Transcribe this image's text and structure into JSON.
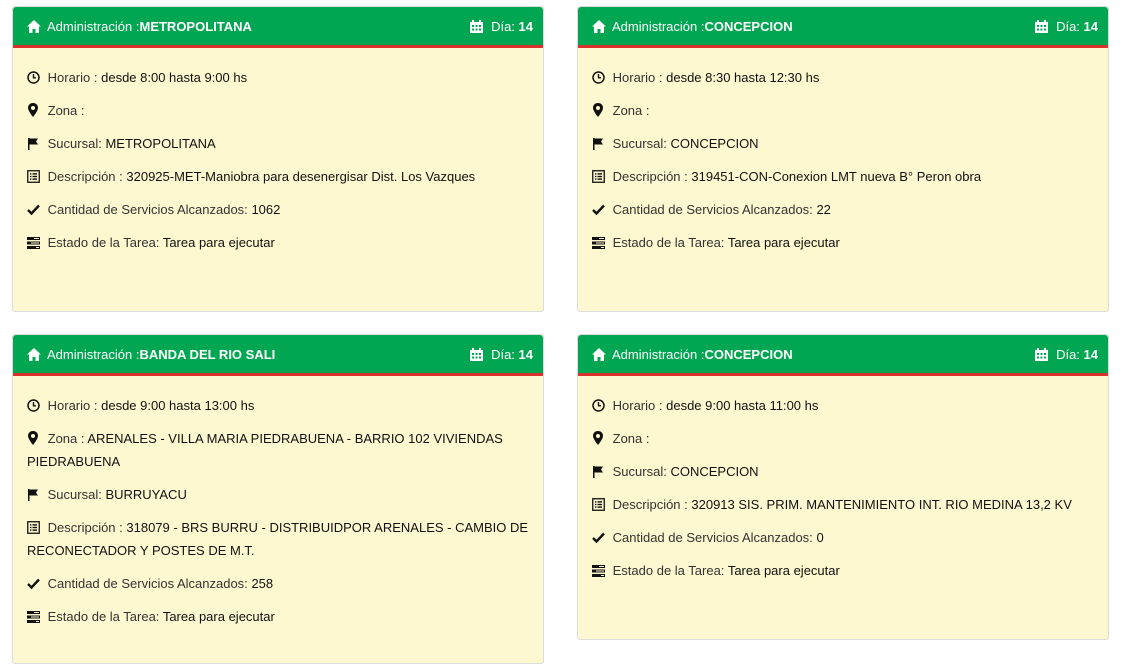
{
  "cards": [
    {
      "admin_label": "Administración :",
      "admin_value": "METROPOLITANA",
      "day_label": "Día:",
      "day_value": "14",
      "horario_label": "Horario :",
      "horario_value": "desde 8:00 hasta 9:00 hs",
      "zona_label": "Zona :",
      "zona_value": "",
      "sucursal_label": "Sucursal:",
      "sucursal_value": "METROPOLITANA",
      "descripcion_label": "Descripción :",
      "descripcion_value": "320925-MET-Maniobra para desenergisar Dist. Los Vazques",
      "servicios_label": "Cantidad de Servicios Alcanzados:",
      "servicios_value": "1062",
      "estado_label": "Estado de la Tarea:",
      "estado_value": "Tarea para ejecutar"
    },
    {
      "admin_label": "Administración :",
      "admin_value": "CONCEPCION",
      "day_label": "Día:",
      "day_value": "14",
      "horario_label": "Horario :",
      "horario_value": "desde 8:30 hasta 12:30 hs",
      "zona_label": "Zona :",
      "zona_value": "",
      "sucursal_label": "Sucursal:",
      "sucursal_value": "CONCEPCION",
      "descripcion_label": "Descripción :",
      "descripcion_value": "319451-CON-Conexion LMT nueva B° Peron obra",
      "servicios_label": "Cantidad de Servicios Alcanzados:",
      "servicios_value": "22",
      "estado_label": "Estado de la Tarea:",
      "estado_value": "Tarea para ejecutar"
    },
    {
      "admin_label": "Administración :",
      "admin_value": "BANDA DEL RIO SALI",
      "day_label": "Día:",
      "day_value": "14",
      "horario_label": "Horario :",
      "horario_value": "desde 9:00 hasta 13:00 hs",
      "zona_label": "Zona :",
      "zona_value": "ARENALES - VILLA MARIA PIEDRABUENA - BARRIO 102 VIVIENDAS PIEDRABUENA",
      "sucursal_label": "Sucursal:",
      "sucursal_value": "BURRUYACU",
      "descripcion_label": "Descripción :",
      "descripcion_value": "318079 - BRS BURRU - DISTRIBUIDPOR ARENALES - CAMBIO DE RECONECTADOR Y POSTES DE M.T.",
      "servicios_label": "Cantidad de Servicios Alcanzados:",
      "servicios_value": "258",
      "estado_label": "Estado de la Tarea:",
      "estado_value": "Tarea para ejecutar"
    },
    {
      "admin_label": "Administración :",
      "admin_value": "CONCEPCION",
      "day_label": "Día:",
      "day_value": "14",
      "horario_label": "Horario :",
      "horario_value": "desde 9:00 hasta 11:00 hs",
      "zona_label": "Zona :",
      "zona_value": "",
      "sucursal_label": "Sucursal:",
      "sucursal_value": "CONCEPCION",
      "descripcion_label": "Descripción :",
      "descripcion_value": "320913 SIS. PRIM. MANTENIMIENTO INT. RIO MEDINA 13,2 KV",
      "servicios_label": "Cantidad de Servicios Alcanzados:",
      "servicios_value": "0",
      "estado_label": "Estado de la Tarea:",
      "estado_value": "Tarea para ejecutar"
    }
  ],
  "colors": {
    "header_bg": "#00a651",
    "header_border": "#d9332b",
    "card_bg": "#fdf8cf"
  },
  "icons": [
    "home-icon",
    "calendar-icon",
    "clock-icon",
    "map-marker-icon",
    "flag-icon",
    "list-icon",
    "check-icon",
    "tasks-icon"
  ]
}
